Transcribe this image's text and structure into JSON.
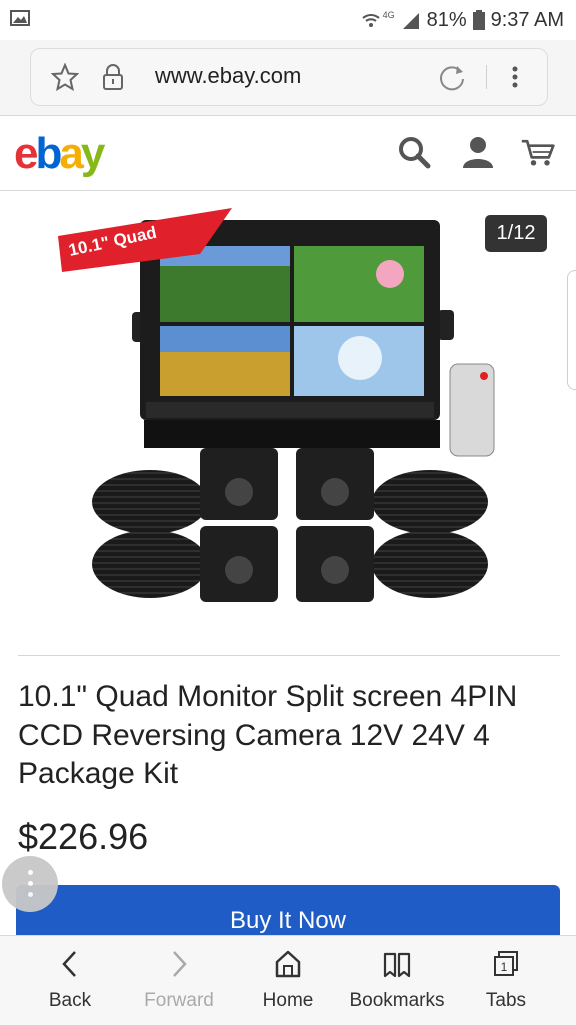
{
  "status_bar": {
    "network": "4G",
    "battery": "81%",
    "time": "9:37 AM"
  },
  "browser": {
    "url": "www.ebay.com"
  },
  "header": {
    "logo_letters": [
      "e",
      "b",
      "a",
      "y"
    ]
  },
  "product": {
    "image_counter": "1/12",
    "badge": "10.1\" Quad",
    "title": "10.1\" Quad Monitor Split screen 4PIN CCD Reversing Camera 12V 24V 4 Package Kit",
    "price": "$226.96",
    "buy_button_label": "Buy It Now"
  },
  "bottom_nav": {
    "back": "Back",
    "forward": "Forward",
    "home": "Home",
    "bookmarks": "Bookmarks",
    "tabs": "Tabs",
    "tabs_count": "1"
  },
  "colors": {
    "ebay_red": "#e53238",
    "ebay_blue": "#0064d2",
    "ebay_yellow": "#f5af02",
    "ebay_green": "#86b817",
    "buy_button": "#1f5cc6"
  }
}
